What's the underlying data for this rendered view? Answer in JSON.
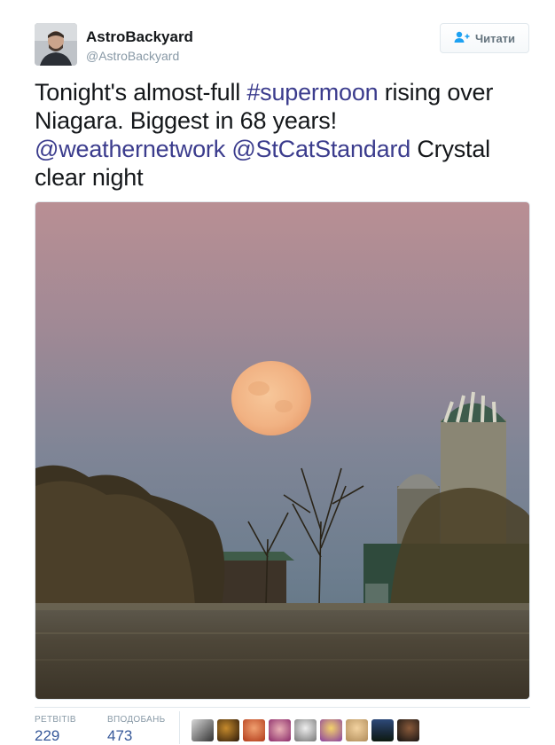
{
  "user": {
    "display_name": "AstroBackyard",
    "handle": "@AstroBackyard"
  },
  "follow_button": {
    "label": "Читати",
    "icon": "add-user-icon"
  },
  "tweet": {
    "segments": [
      {
        "text": "Tonight's almost-full ",
        "link": false
      },
      {
        "text": "#supermoon",
        "link": true
      },
      {
        "text": " rising over Niagara. Biggest in 68 years! ",
        "link": false
      },
      {
        "text": "@weathernetwork",
        "link": true
      },
      {
        "text": " ",
        "link": false
      },
      {
        "text": "@StCatStandard",
        "link": true
      },
      {
        "text": " Crystal clear night",
        "link": false
      }
    ]
  },
  "stats": {
    "retweets_label": "РЕТВІТІВ",
    "retweets_value": "229",
    "likes_label": "ВПОДОБАНЬ",
    "likes_value": "473"
  },
  "likers": [
    {
      "icon": "liker-avatar"
    },
    {
      "icon": "liker-avatar"
    },
    {
      "icon": "liker-avatar"
    },
    {
      "icon": "liker-avatar"
    },
    {
      "icon": "liker-avatar"
    },
    {
      "icon": "liker-avatar"
    },
    {
      "icon": "liker-avatar"
    },
    {
      "icon": "liker-avatar"
    },
    {
      "icon": "liker-avatar"
    }
  ],
  "colors": {
    "link": "#3b3c8d",
    "text": "#14171a",
    "muted": "#8899a6"
  }
}
